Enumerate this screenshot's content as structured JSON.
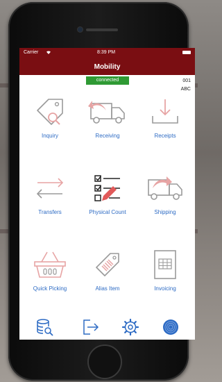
{
  "status_bar": {
    "carrier": "Carrier",
    "time": "8:39 PM"
  },
  "header": {
    "title": "Mobility"
  },
  "connection": {
    "label": "connected",
    "color": "#2f9a34"
  },
  "codes": {
    "line1": "001",
    "line2": "ABC"
  },
  "colors": {
    "header": "#7a0e12",
    "label": "#2d6bc4",
    "icon_pink": "#e7a4a4",
    "icon_grey": "#9a9a9a"
  },
  "tiles": [
    {
      "label": "Inquiry",
      "icon": "price-tag-search-icon"
    },
    {
      "label": "Receiving",
      "icon": "truck-arrow-back-icon"
    },
    {
      "label": "Receipts",
      "icon": "download-tray-icon"
    },
    {
      "label": "Transfers",
      "icon": "transfer-arrows-icon"
    },
    {
      "label": "Physical Count",
      "icon": "checklist-pencil-icon"
    },
    {
      "label": "Shipping",
      "icon": "truck-arrow-forward-icon"
    },
    {
      "label": "Quick Picking",
      "icon": "shopping-basket-icon"
    },
    {
      "label": "Alias Item",
      "icon": "barcode-tag-icon"
    },
    {
      "label": "Invoicing",
      "icon": "invoice-document-icon"
    }
  ],
  "tab_bar": [
    "database-search-icon",
    "logout-icon",
    "settings-gear-icon",
    "fingerprint-icon"
  ]
}
